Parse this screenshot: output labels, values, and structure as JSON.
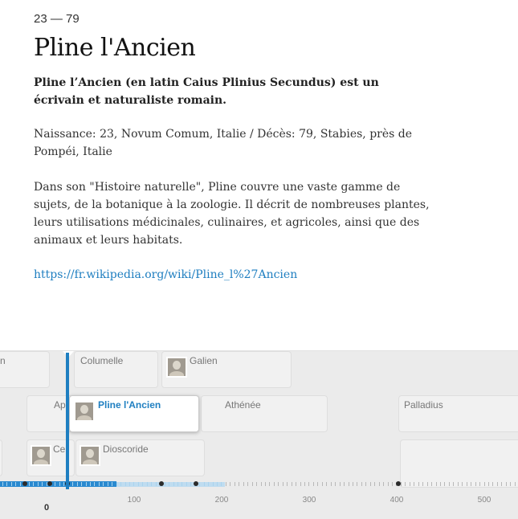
{
  "article": {
    "dates": "23 — 79",
    "title": "Pline l'Ancien",
    "summary": "Pline l’Ancien (en latin Caius Plinius Secundus) est un écrivain et naturaliste romain.",
    "life_info": "Naissance: 23, Novum Comum, Italie / Décès: 79, Stabies, près de Pompéi, Italie",
    "description": "Dans son \"Histoire naturelle\", Pline couvre une vaste gamme de sujets, de la botanique à la zoologie. Il décrit de nombreuses plantes, leurs utilisations médicinales, culinaires, et agricoles, ainsi que des animaux et leurs habitats.",
    "wiki_link": "https://fr.wikipedia.org/wiki/Pline_l%27Ancien"
  },
  "timeline": {
    "cards": {
      "partial_n": "n",
      "columelle": "Columelle",
      "galien": "Galien",
      "partial_ap": "Ap",
      "pline": "Pline l'Ancien",
      "athenee": "Athénée",
      "palladius": "Palladius",
      "partial_ce": "Ce",
      "dioscoride": "Dioscoride"
    },
    "axis": {
      "zero_label": "0",
      "labels": [
        "100",
        "200",
        "300",
        "400",
        "500"
      ]
    },
    "colors": {
      "accent": "#1f7fc1",
      "range": "#2a8ad0",
      "range_light": "#bfdcf0"
    }
  }
}
